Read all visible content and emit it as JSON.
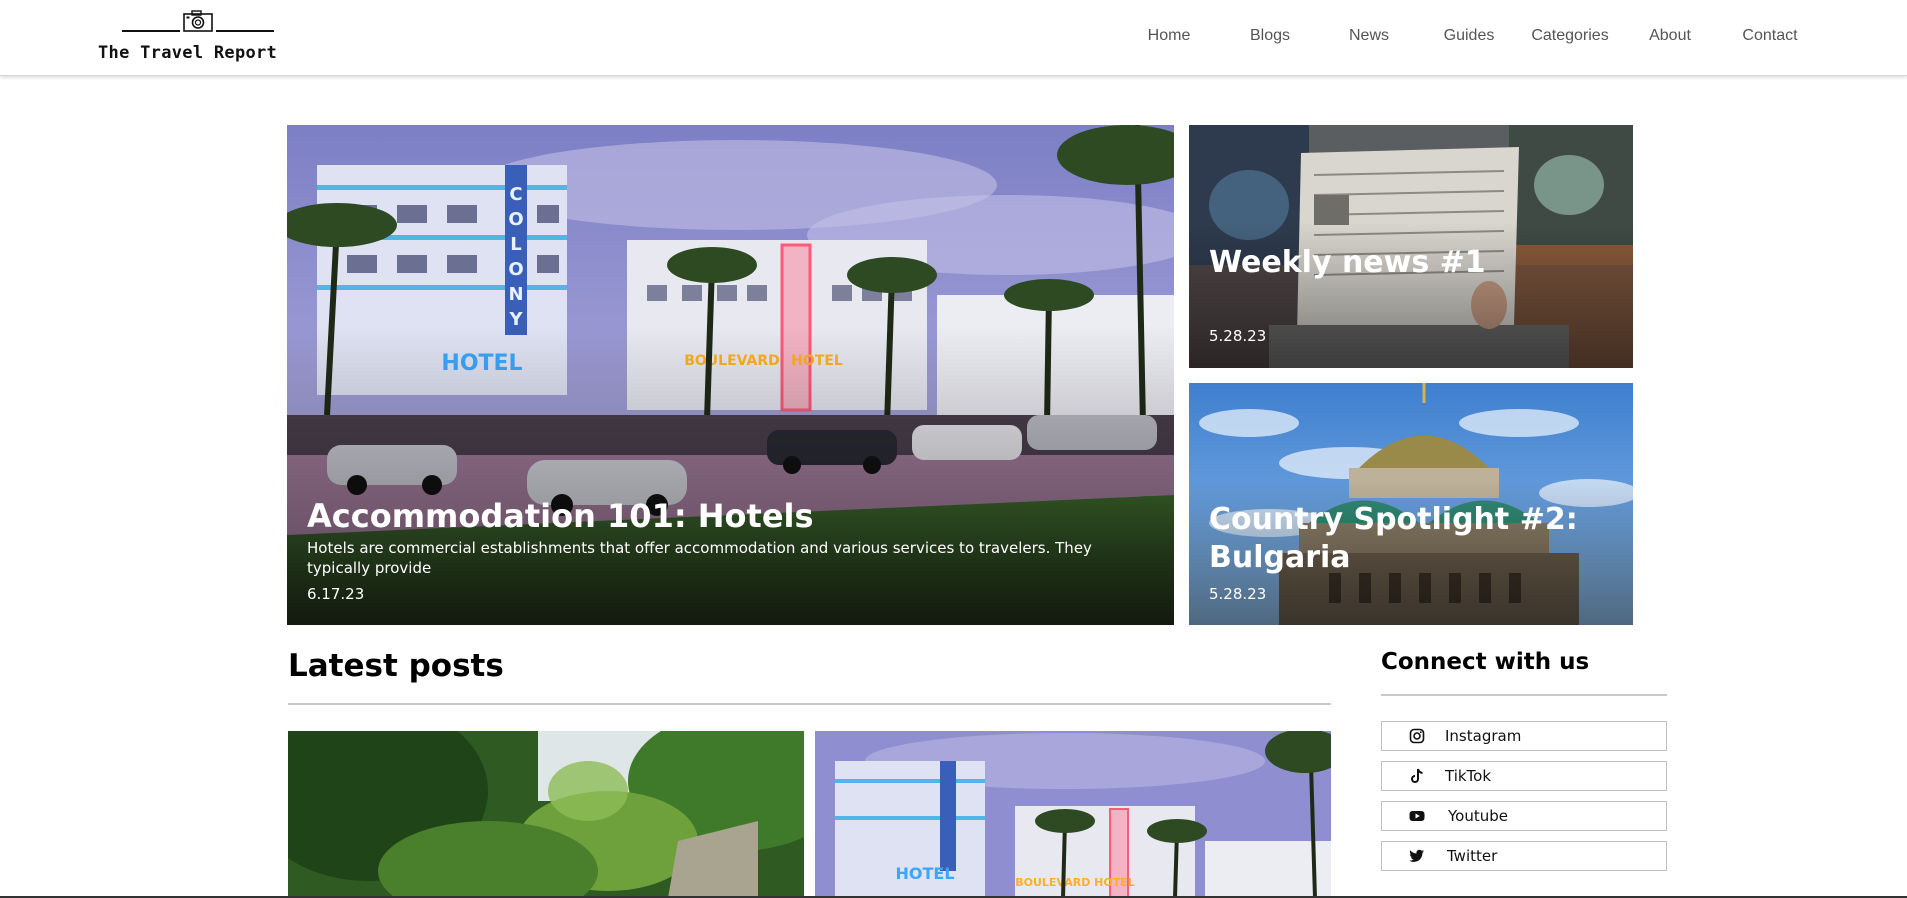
{
  "site": {
    "title": "The Travel Report"
  },
  "nav": {
    "items": [
      {
        "label": "Home"
      },
      {
        "label": "Blogs"
      },
      {
        "label": "News"
      },
      {
        "label": "Guides"
      },
      {
        "label": "Categories"
      },
      {
        "label": "About"
      },
      {
        "label": "Contact"
      }
    ]
  },
  "featured": {
    "main": {
      "title": "Accommodation 101: Hotels",
      "description": "Hotels are commercial establishments that offer accommodation and various services to travelers. They typically provide",
      "date": "6.17.23",
      "image": "miami-art-deco-hotels-photo"
    },
    "side": [
      {
        "title": "Weekly news #1",
        "date": "5.28.23",
        "image": "person-reading-newspaper-photo"
      },
      {
        "title": "Country Spotlight #2: Bulgaria",
        "date": "5.28.23",
        "image": "cathedral-dome-photo"
      }
    ]
  },
  "latest": {
    "heading": "Latest posts",
    "posts": [
      {
        "image": "jungle-waterfall-photo"
      },
      {
        "image": "miami-art-deco-hotels-photo"
      }
    ]
  },
  "connect": {
    "heading": "Connect with us",
    "links": [
      {
        "label": "Instagram",
        "icon": "instagram-icon"
      },
      {
        "label": "TikTok",
        "icon": "tiktok-icon"
      },
      {
        "label": "Youtube",
        "icon": "youtube-icon"
      },
      {
        "label": "Twitter",
        "icon": "twitter-icon"
      }
    ]
  },
  "colors": {
    "nav_text": "#555555",
    "rule": "#c8c8c8",
    "overlay_text": "#ffffff"
  }
}
